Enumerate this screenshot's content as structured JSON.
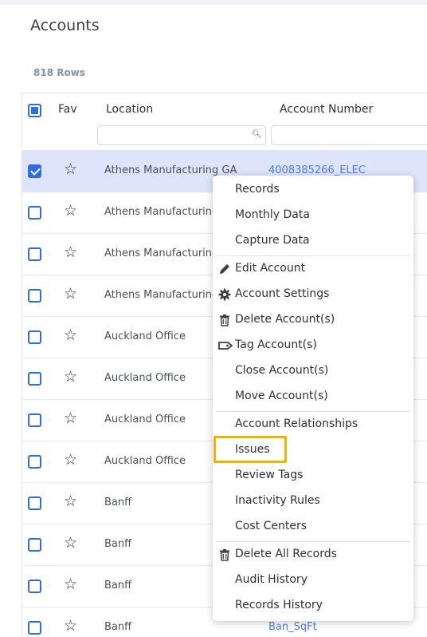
{
  "page": {
    "title": "Accounts",
    "rows_count": "818 Rows"
  },
  "grid": {
    "headers": {
      "fav": "Fav",
      "location": "Location",
      "account_number": "Account Number"
    },
    "rows": [
      {
        "location": "Athens Manufacturing GA",
        "account": "4008385266_ELEC",
        "selected": true
      },
      {
        "location": "Athens Manufacturing",
        "account": "",
        "selected": false
      },
      {
        "location": "Athens Manufacturing",
        "account": "",
        "selected": false
      },
      {
        "location": "Athens Manufacturing",
        "account": "",
        "selected": false
      },
      {
        "location": "Auckland Office",
        "account": "",
        "selected": false
      },
      {
        "location": "Auckland Office",
        "account": "",
        "selected": false
      },
      {
        "location": "Auckland Office",
        "account": "",
        "selected": false
      },
      {
        "location": "Auckland Office",
        "account": "",
        "selected": false
      },
      {
        "location": "Banff",
        "account": "",
        "selected": false
      },
      {
        "location": "Banff",
        "account": "",
        "selected": false
      },
      {
        "location": "Banff",
        "account": "",
        "selected": false
      },
      {
        "location": "Banff",
        "account": "Ban_SqFt",
        "selected": false
      }
    ]
  },
  "context_menu": {
    "items": [
      {
        "label": "Records",
        "icon": ""
      },
      {
        "label": "Monthly Data",
        "icon": ""
      },
      {
        "label": "Capture Data",
        "icon": ""
      },
      {
        "label": "Edit Account",
        "icon": "pencil-icon"
      },
      {
        "label": "Account Settings",
        "icon": "gear-icon"
      },
      {
        "label": "Delete Account(s)",
        "icon": "trash-icon"
      },
      {
        "label": "Tag Account(s)",
        "icon": "tag-icon"
      },
      {
        "label": "Close Account(s)",
        "icon": ""
      },
      {
        "label": "Move Account(s)",
        "icon": ""
      },
      {
        "label": "Account Relationships",
        "icon": ""
      },
      {
        "label": "Issues",
        "icon": "",
        "highlighted": true
      },
      {
        "label": "Review Tags",
        "icon": ""
      },
      {
        "label": "Inactivity Rules",
        "icon": ""
      },
      {
        "label": "Cost Centers",
        "icon": ""
      },
      {
        "label": "Delete All Records",
        "icon": "trash-icon"
      },
      {
        "label": "Audit History",
        "icon": ""
      },
      {
        "label": "Records History",
        "icon": ""
      }
    ]
  },
  "colors": {
    "accent": "#2f6ce8",
    "link": "#4d7ee6",
    "highlight": "#f0b400",
    "selected_row": "#dde4fb"
  }
}
